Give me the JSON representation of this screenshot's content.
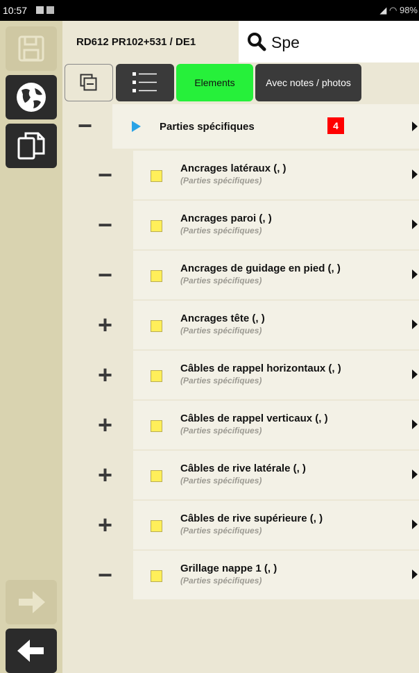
{
  "status": {
    "time": "10:57",
    "battery": "98%"
  },
  "header": {
    "title": "RD612 PR102+531 / DE1",
    "search_value": "Spe"
  },
  "toolbar": {
    "elements_label": "Elements",
    "notes_label": "Avec notes / photos"
  },
  "group": {
    "label": "Parties spécifiques",
    "count": "4"
  },
  "items": [
    {
      "name": "Ancrages latéraux (, )",
      "sub": "(Parties spécifiques)",
      "toggle": "−"
    },
    {
      "name": "Ancrages paroi (, )",
      "sub": "(Parties spécifiques)",
      "toggle": "−"
    },
    {
      "name": "Ancrages de guidage en pied (, )",
      "sub": "(Parties spécifiques)",
      "toggle": "−"
    },
    {
      "name": "Ancrages tête (, )",
      "sub": "(Parties spécifiques)",
      "toggle": "+"
    },
    {
      "name": "Câbles de rappel horizontaux (, )",
      "sub": "(Parties spécifiques)",
      "toggle": "+"
    },
    {
      "name": "Câbles de rappel verticaux (, )",
      "sub": "(Parties spécifiques)",
      "toggle": "+"
    },
    {
      "name": "Câbles de rive latérale (, )",
      "sub": "(Parties spécifiques)",
      "toggle": "+"
    },
    {
      "name": "Câbles de rive supérieure (, )",
      "sub": "(Parties spécifiques)",
      "toggle": "+"
    },
    {
      "name": "Grillage nappe 1 (, )",
      "sub": "(Parties spécifiques)",
      "toggle": "−"
    }
  ],
  "colors": {
    "accent_green": "#26f03a",
    "badge_red": "#ff0000",
    "item_square": "#ffef5a",
    "sidebar": "#d9d3b0"
  }
}
